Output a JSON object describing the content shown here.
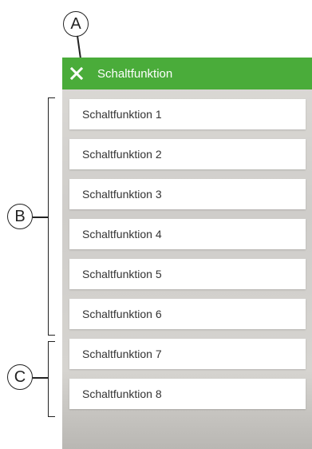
{
  "callouts": {
    "a": "A",
    "b": "B",
    "c": "C"
  },
  "header": {
    "title": "Schaltfunktion",
    "close_icon": "close-icon",
    "background_color": "#4aac3a"
  },
  "list": {
    "items": [
      {
        "label": "Schaltfunktion 1"
      },
      {
        "label": "Schaltfunktion 2"
      },
      {
        "label": "Schaltfunktion 3"
      },
      {
        "label": "Schaltfunktion 4"
      },
      {
        "label": "Schaltfunktion 5"
      },
      {
        "label": "Schaltfunktion 6"
      },
      {
        "label": "Schaltfunktion 7"
      },
      {
        "label": "Schaltfunktion 8"
      }
    ]
  }
}
